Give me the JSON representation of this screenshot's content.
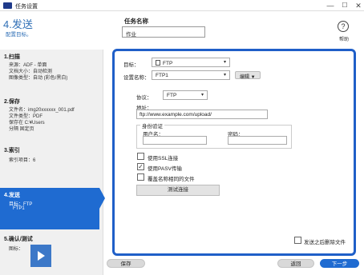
{
  "window": {
    "title": "任务设置",
    "minimize": "—",
    "maximize": "☐",
    "close": "✕"
  },
  "header": {
    "step_heading": "4.发送",
    "step_sub": "配置目标。",
    "task_name_label": "任务名称",
    "task_name_value": "作业",
    "help_label": "帮助",
    "help_glyph": "?"
  },
  "sidebar": {
    "items": [
      {
        "title": "1.扫描",
        "lines": [
          "来源：ADF - 单面",
          "文档大小：自动检测",
          "图像类型：自动 (彩色/黑白)"
        ],
        "active": false
      },
      {
        "title": "2.保存",
        "lines": [
          "文件名：img20xxxxxx_001.pdf",
          "文件类型：PDF",
          "保存在 C:¥Users",
          "分隔 固定页"
        ],
        "active": false
      },
      {
        "title": "3.索引",
        "lines": [
          "索引项目：6"
        ],
        "active": false
      },
      {
        "title": "4.发送",
        "lines": [
          "目标：FTP",
          "FTP1"
        ],
        "active": true
      },
      {
        "title": "5.确认/测试",
        "lines": [
          "图标："
        ],
        "active": false
      }
    ]
  },
  "panel": {
    "target_label": "目标：",
    "target_value": "FTP",
    "setting_name_label": "设置名称：",
    "setting_name_value": "FTP1",
    "edit_button": "编辑 ▼",
    "protocol_label": "协议：",
    "protocol_value": "FTP",
    "address_label": "地址：",
    "address_value": "ftp://www.example.com/upload/",
    "auth_group_title": "身份验证",
    "username_label": "用户名：",
    "username_value": "",
    "password_label": "密码：",
    "password_value": "",
    "use_ssl": {
      "label": "使用SSL连接",
      "checked": false
    },
    "use_pasv": {
      "label": "使用PASV传输",
      "checked": true
    },
    "overwrite": {
      "label": "覆盖名称相同的文件",
      "checked": false
    },
    "test_button": "测试连接",
    "delete_after_send": {
      "label": "发送之后删除文件",
      "checked": false
    },
    "caret": "▾",
    "check_mark": "✓"
  },
  "footer": {
    "save_button": "保存",
    "back_button": "返回",
    "next_button": "下一步"
  },
  "colors": {
    "accent": "#1f6bd1",
    "panel_border": "#1f5fc8",
    "heading": "#2f6fb6"
  }
}
